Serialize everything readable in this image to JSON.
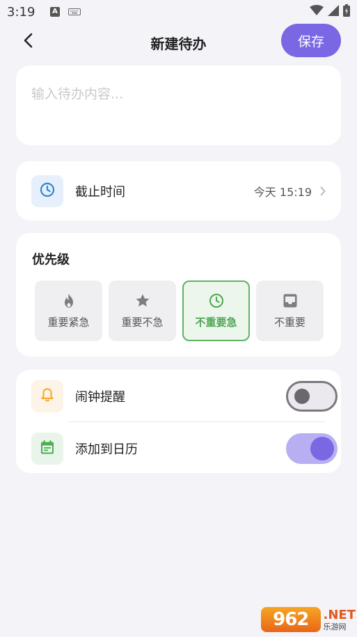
{
  "status_bar": {
    "time": "3:19",
    "app_icon_letter": "A"
  },
  "header": {
    "back_icon": "chevron-left-icon",
    "title": "新建待办",
    "save_label": "保存"
  },
  "content": {
    "placeholder": "输入待办内容...",
    "value": ""
  },
  "deadline": {
    "icon": "clock-icon",
    "label": "截止时间",
    "value": "今天 15:19"
  },
  "priority": {
    "title": "优先级",
    "options": [
      {
        "label": "重要紧急",
        "icon": "fire-icon",
        "selected": false
      },
      {
        "label": "重要不急",
        "icon": "star-icon",
        "selected": false
      },
      {
        "label": "不重要急",
        "icon": "clock-icon",
        "selected": true
      },
      {
        "label": "不重要",
        "icon": "inbox-icon",
        "selected": false
      }
    ]
  },
  "toggles": [
    {
      "label": "闹钟提醒",
      "icon": "bell-icon",
      "enabled": false
    },
    {
      "label": "添加到日历",
      "icon": "calendar-icon",
      "enabled": true
    }
  ],
  "watermark": {
    "logo": "962",
    "net": ".NET",
    "cn": "乐游网"
  },
  "colors": {
    "accent": "#7a67e3",
    "selected_green": "#5fb361",
    "clock_blue": "#2f86d6",
    "bell_orange": "#f5a623",
    "calendar_green": "#4caf50"
  }
}
